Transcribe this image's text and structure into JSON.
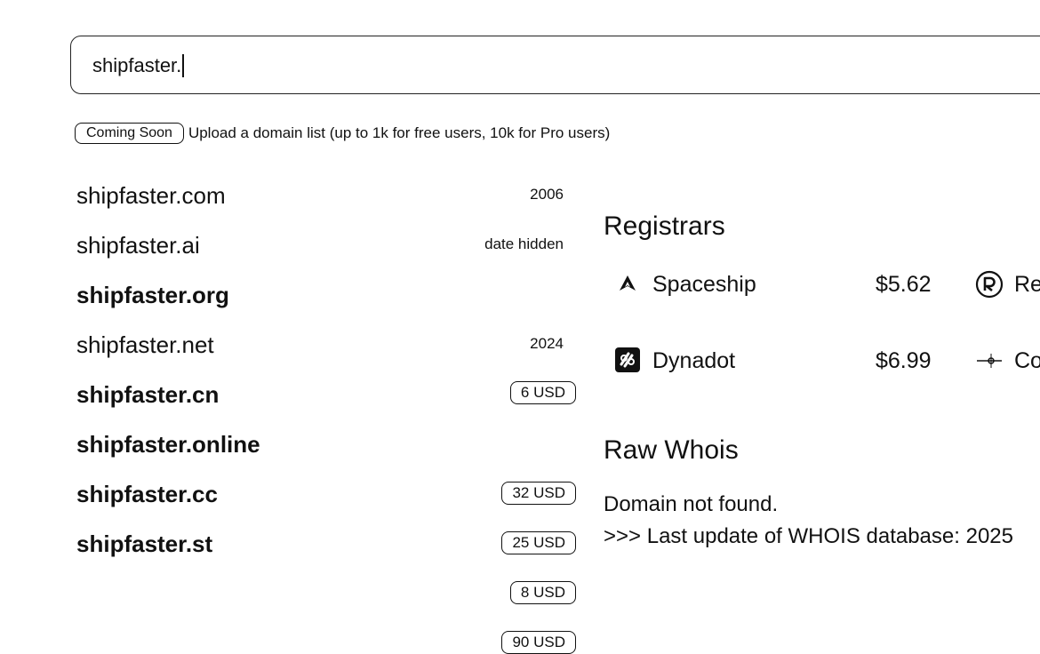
{
  "search": {
    "value": "shipfaster."
  },
  "upload": {
    "badge": "Coming Soon",
    "text": "Upload a domain list (up to 1k for free users, 10k for Pro users)"
  },
  "domains": [
    {
      "name": "shipfaster.com",
      "meta": "2006",
      "price": null,
      "available": false
    },
    {
      "name": "shipfaster.ai",
      "meta": "date hidden",
      "price": null,
      "available": false
    },
    {
      "name": "shipfaster.org",
      "meta": null,
      "price": "6 USD",
      "available": true
    },
    {
      "name": "shipfaster.net",
      "meta": "2024",
      "price": null,
      "available": false
    },
    {
      "name": "shipfaster.cn",
      "meta": null,
      "price": "32 USD",
      "available": true
    },
    {
      "name": "shipfaster.online",
      "meta": null,
      "price": "25 USD",
      "available": true
    },
    {
      "name": "shipfaster.cc",
      "meta": null,
      "price": "8 USD",
      "available": true
    },
    {
      "name": "shipfaster.st",
      "meta": null,
      "price": "90 USD",
      "available": true
    }
  ],
  "registrars": {
    "title": "Registrars",
    "rows": [
      {
        "name": "Spaceship",
        "price": "$5.62",
        "icon": "spaceship-logo-icon",
        "second_name": "Re",
        "second_icon": "registrar-r-logo-icon"
      },
      {
        "name": "Dynadot",
        "price": "$6.99",
        "icon": "dynadot-logo-icon",
        "second_name": "Co",
        "second_icon": "registrar-co-logo-icon"
      }
    ]
  },
  "whois": {
    "title": "Raw Whois",
    "lines": [
      "Domain not found.",
      ">>> Last update of WHOIS database: 2025"
    ]
  }
}
